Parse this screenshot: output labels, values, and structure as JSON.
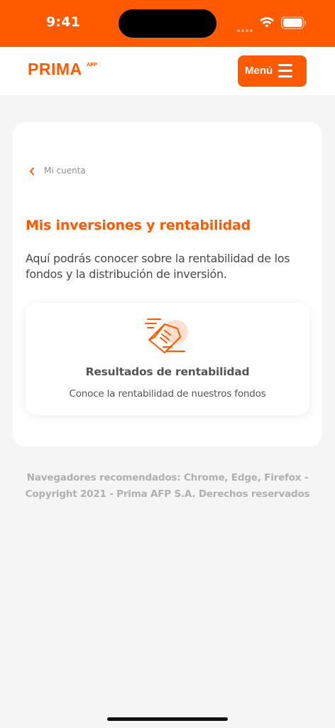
{
  "status_bar": {
    "time": "9:41"
  },
  "header": {
    "logo_text": "PRIMA",
    "logo_sup": "AFP",
    "menu_label": "Menú"
  },
  "breadcrumb": {
    "label": "Mi cuenta"
  },
  "main": {
    "title": "Mis inversiones y rentabilidad",
    "description": "Aquí podrás conocer sobre la rentabilidad de los fondos y la distribución de inversión."
  },
  "result_card": {
    "icon": "document-icon",
    "title": "Resultados de rentabilidad",
    "subtitle": "Conoce la rentabilidad de nuestros fondos"
  },
  "footer": {
    "line1": "Navegadores recomendados: Chrome, Edge, Firefox -",
    "line2": "Copyright 2021 - Prima AFP S.A. Derechos reservados"
  },
  "colors": {
    "brand": "#ff5a00",
    "background": "#f5f5f5",
    "text": "#4a4a4a",
    "footer_text": "#b0b0b0"
  }
}
